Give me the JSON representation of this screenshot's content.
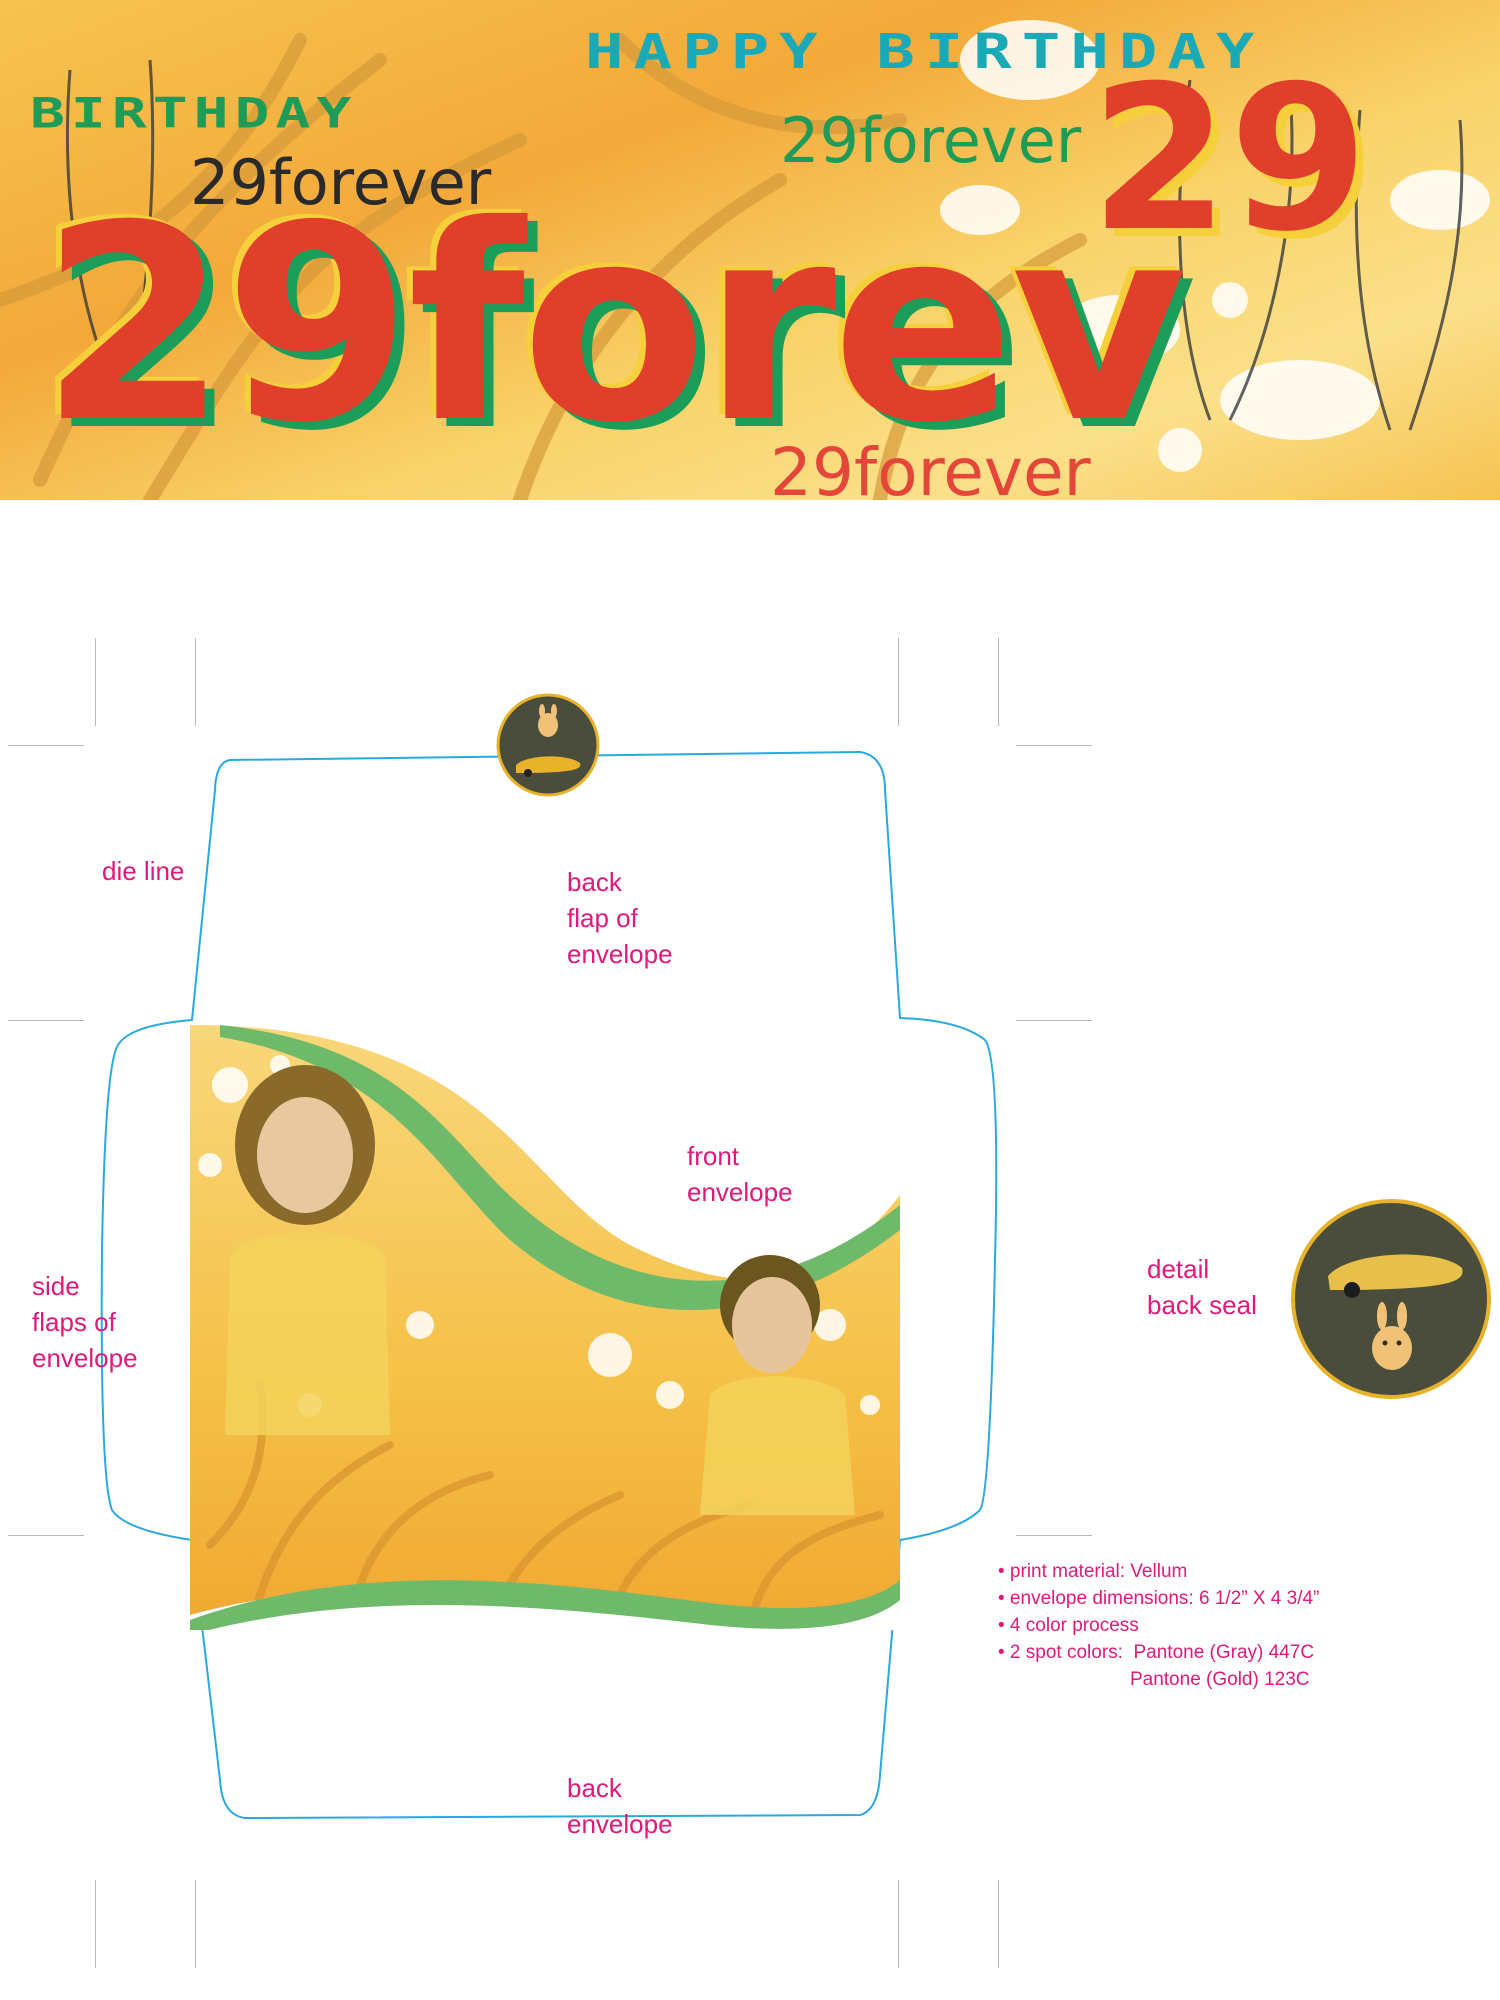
{
  "banner": {
    "happy_birthday": "HAPPY BIRTHDAY",
    "birthday": "BIRTHDAY",
    "small_tag_1": "29forever",
    "small_tag_2": "29forever",
    "small_tag_3": "29forever",
    "big_logo": "29forev",
    "big_number": "29"
  },
  "labels": {
    "die_line": "die line",
    "back_flap": "back\nflap of\nenvelope",
    "front_envelope": "front\nenvelope",
    "side_flaps": "side\nflaps of\nenvelope",
    "detail_back_seal": "detail\nback seal",
    "back_envelope": "back\nenvelope"
  },
  "specs": [
    "• print material: Vellum",
    "• envelope dimensions: 6 1/2” X 4 3/4”",
    "• 4 color process",
    "• 2 spot colors:  Pantone (Gray) 447C",
    "                         Pantone (Gold) 123C"
  ],
  "colors": {
    "label": "#e0197a",
    "die_line": "#29a9e0",
    "green_wave": "#6fba6a",
    "seal_gray": "#4a4d3c",
    "seal_gold": "#e8b32a"
  },
  "icons": {
    "seal_car": "car-icon",
    "seal_bunny": "bunny-icon"
  }
}
